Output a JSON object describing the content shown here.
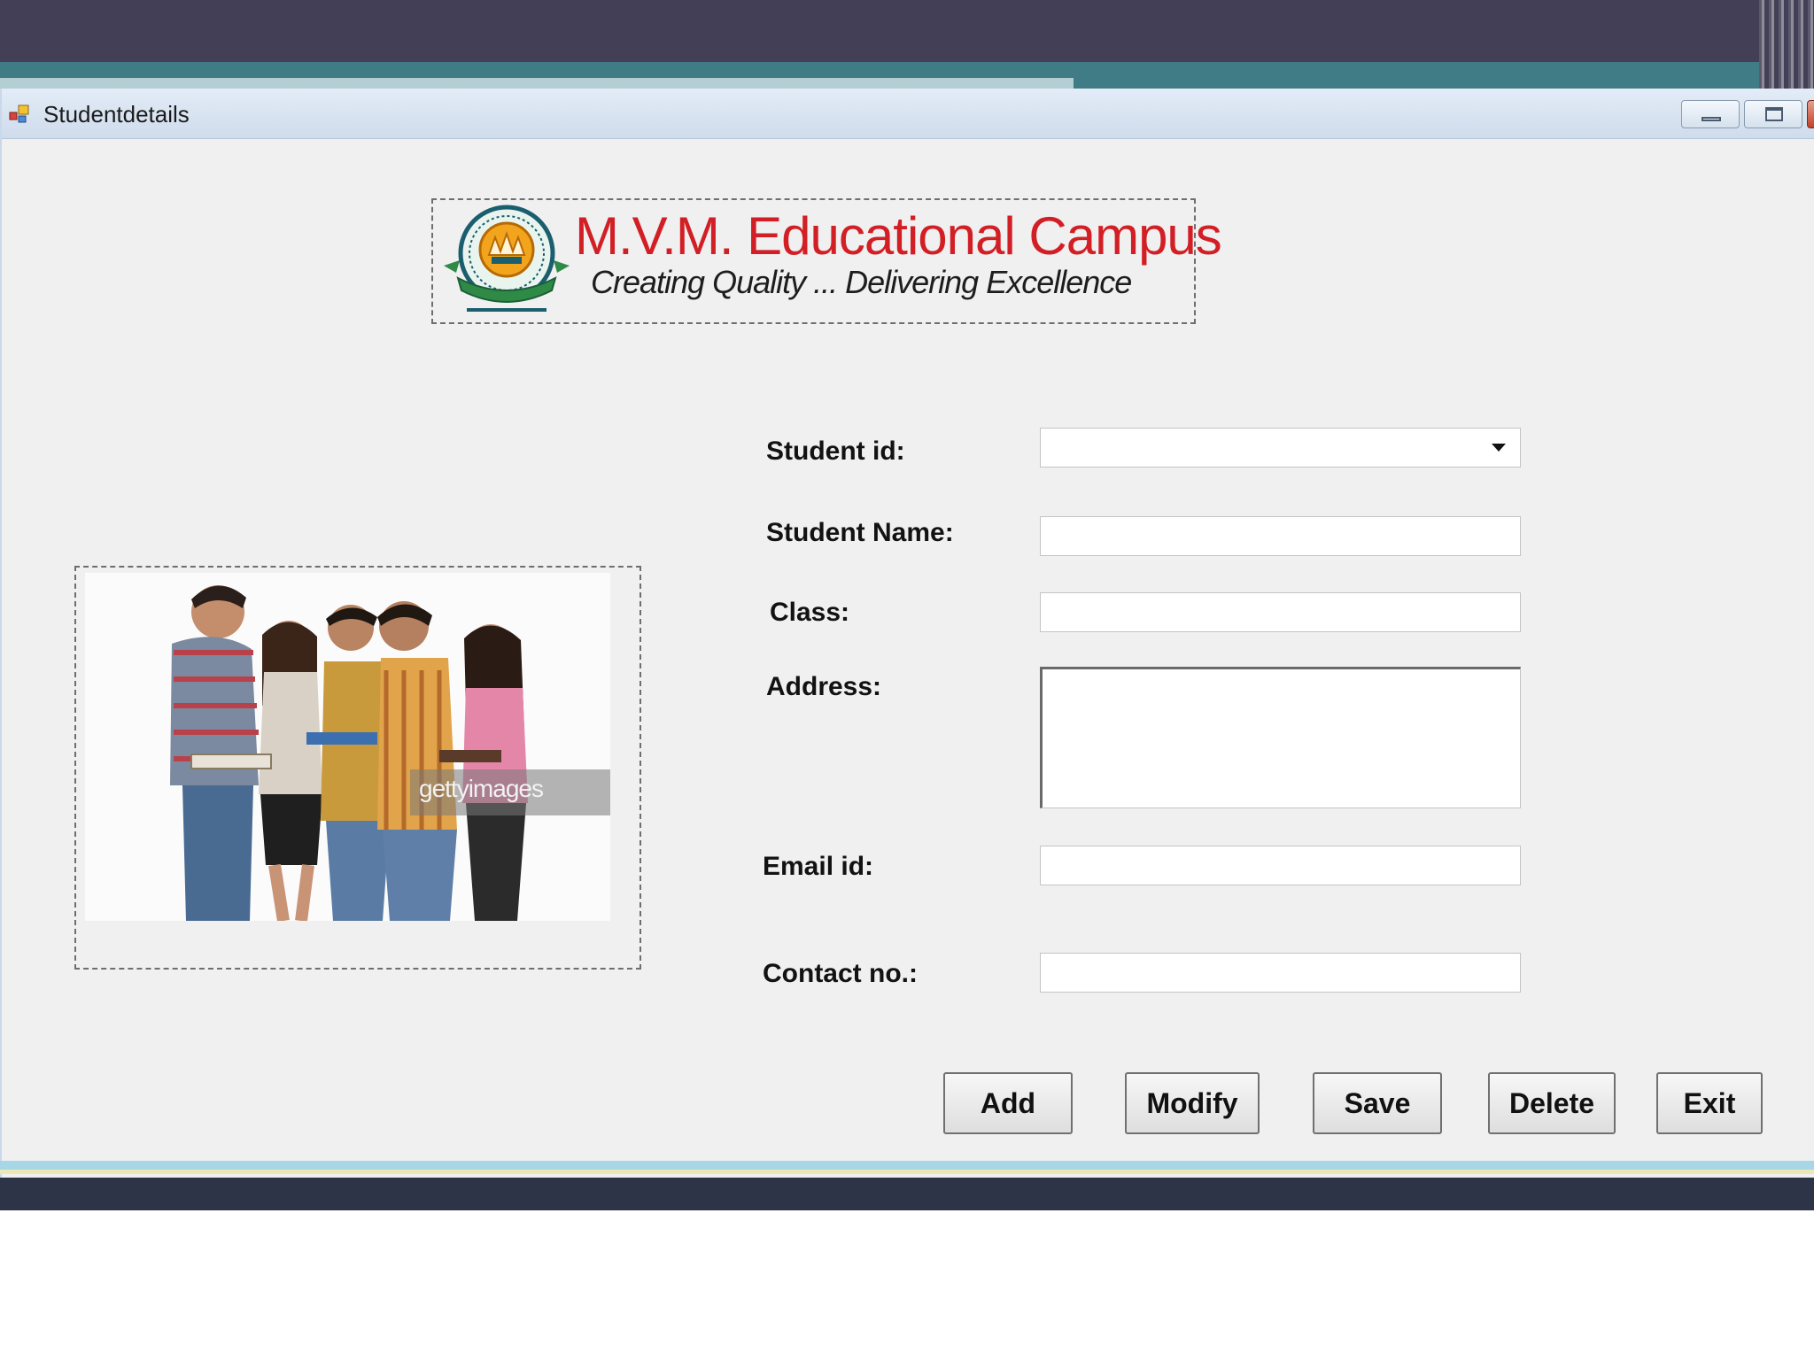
{
  "window": {
    "title": "Studentdetails"
  },
  "logo": {
    "title": "M.V.M. Educational Campus",
    "tagline": "Creating Quality ... Delivering Excellence"
  },
  "photo": {
    "watermark": "gettyimages"
  },
  "form": {
    "student_id_label": "Student id:",
    "student_id_value": "",
    "student_name_label": "Student Name:",
    "student_name_value": "",
    "class_label": "Class:",
    "class_value": "",
    "address_label": "Address:",
    "address_value": "",
    "email_label": "Email id:",
    "email_value": "",
    "contact_label": "Contact no.:",
    "contact_value": ""
  },
  "buttons": {
    "add": "Add",
    "modify": "Modify",
    "save": "Save",
    "delete": "Delete",
    "exit": "Exit"
  },
  "colors": {
    "logo_red": "#d21f25",
    "slide_dark": "#433f56",
    "slide_teal": "#3f7c86",
    "window_bg": "#f0f0f0"
  }
}
